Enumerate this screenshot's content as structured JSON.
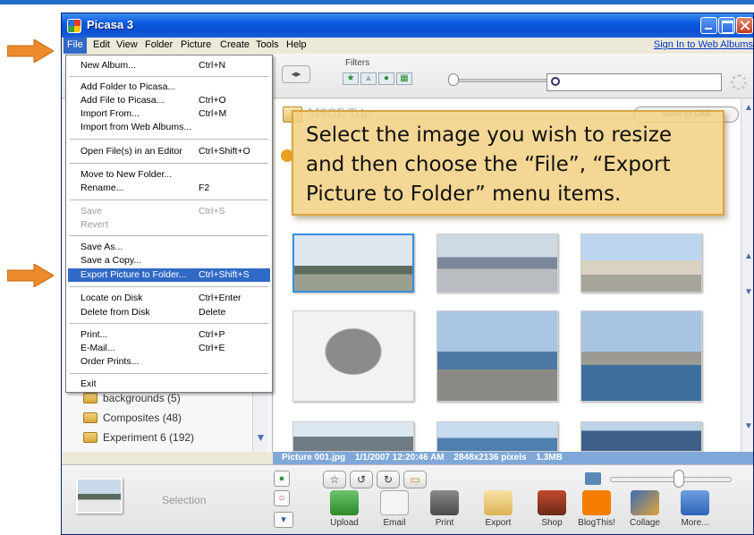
{
  "window": {
    "title": "Picasa 3"
  },
  "menubar": {
    "items": [
      "File",
      "Edit",
      "View",
      "Folder",
      "Picture",
      "Create",
      "Tools",
      "Help"
    ],
    "sign_in": "Sign In to Web Albums"
  },
  "toolbar": {
    "filters_label": "Filters",
    "search_value": ""
  },
  "file_menu": {
    "items": [
      {
        "label": "New Album...",
        "shortcut": "Ctrl+N"
      },
      {
        "label": "Add Folder to Picasa...",
        "shortcut": ""
      },
      {
        "label": "Add File to Picasa...",
        "shortcut": "Ctrl+O"
      },
      {
        "label": "Import From...",
        "shortcut": "Ctrl+M"
      },
      {
        "label": "Import from Web Albums...",
        "shortcut": ""
      },
      {
        "label": "Open File(s) in an Editor",
        "shortcut": "Ctrl+Shift+O"
      },
      {
        "label": "Move to New Folder...",
        "shortcut": ""
      },
      {
        "label": "Rename...",
        "shortcut": "F2"
      },
      {
        "label": "Save",
        "shortcut": "Ctrl+S"
      },
      {
        "label": "Revert",
        "shortcut": ""
      },
      {
        "label": "Save As...",
        "shortcut": ""
      },
      {
        "label": "Save a Copy...",
        "shortcut": ""
      },
      {
        "label": "Export Picture to Folder...",
        "shortcut": "Ctrl+Shift+S"
      },
      {
        "label": "Locate on Disk",
        "shortcut": "Ctrl+Enter"
      },
      {
        "label": "Delete from Disk",
        "shortcut": "Delete"
      },
      {
        "label": "Print...",
        "shortcut": "Ctrl+P"
      },
      {
        "label": "E-Mail...",
        "shortcut": "Ctrl+E"
      },
      {
        "label": "Order Prints...",
        "shortcut": ""
      },
      {
        "label": "Exit",
        "shortcut": ""
      }
    ]
  },
  "library": {
    "folders": [
      {
        "label": "backgrounds (5)"
      },
      {
        "label": "Composites (48)"
      },
      {
        "label": "Experiment 6 (192)"
      }
    ]
  },
  "photos": {
    "folder_title": "MSOE Trip",
    "save_to_disk": "Save to Disk"
  },
  "callout": {
    "text": "Select the image you wish to resize and then choose the “File”, “Export Picture to Folder” menu items."
  },
  "status": {
    "filename": "Picture 001.jpg",
    "datetime": "1/1/2007 12:20:46 AM",
    "dimensions": "2848x2136 pixels",
    "size": "1.3MB"
  },
  "tray": {
    "selection_label": "Selection",
    "buttons": [
      "Upload",
      "Email",
      "Print",
      "Export",
      "Shop",
      "BlogThis!",
      "Collage",
      "More..."
    ]
  },
  "colors": {
    "highlight": "#316ac5",
    "callout": "#f2d082",
    "arrow": "#ed8a2c",
    "status_bar": "#7fa8d9"
  }
}
